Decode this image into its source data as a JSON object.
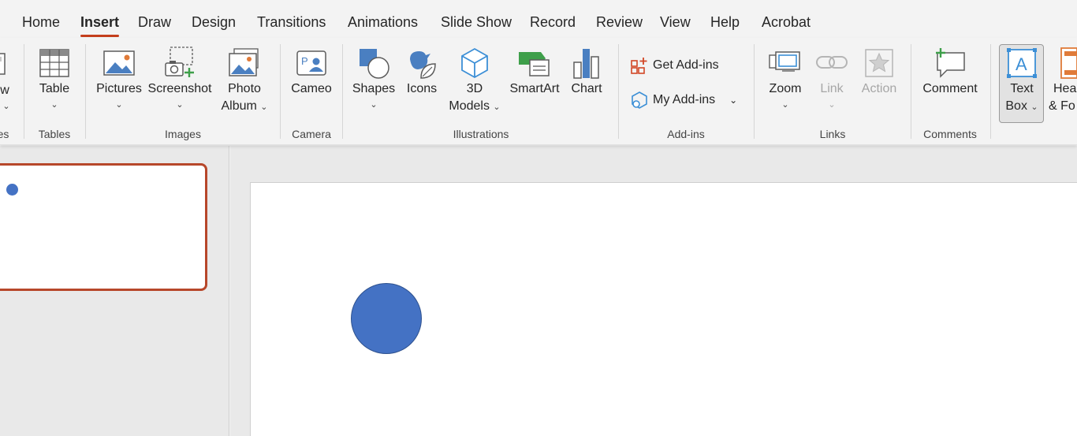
{
  "tabs": [
    {
      "label": "Home",
      "left": 0
    },
    {
      "label": "Insert",
      "active": true
    },
    {
      "label": "Draw"
    },
    {
      "label": "Design"
    },
    {
      "label": "Transitions"
    },
    {
      "label": "Animations"
    },
    {
      "label": "Slide Show"
    },
    {
      "label": "Record"
    },
    {
      "label": "Review"
    },
    {
      "label": "View"
    },
    {
      "label": "Help"
    },
    {
      "label": "Acrobat"
    }
  ],
  "ribbon": {
    "partial_left_label": "w",
    "partial_left_group": "es",
    "tables": {
      "table": "Table",
      "group": "Tables"
    },
    "images": {
      "pictures": "Pictures",
      "screenshot": "Screenshot",
      "photo_album_1": "Photo",
      "photo_album_2": "Album",
      "group": "Images"
    },
    "camera": {
      "cameo": "Cameo",
      "group": "Camera"
    },
    "illustrations": {
      "shapes": "Shapes",
      "icons": "Icons",
      "models_1": "3D",
      "models_2": "Models",
      "smartart": "SmartArt",
      "chart": "Chart",
      "group": "Illustrations"
    },
    "addins": {
      "get": "Get Add-ins",
      "my": "My Add-ins",
      "group": "Add-ins"
    },
    "links": {
      "zoom": "Zoom",
      "link": "Link",
      "action": "Action",
      "group": "Links"
    },
    "comments": {
      "comment": "Comment",
      "group": "Comments"
    },
    "text": {
      "textbox_1": "Text",
      "textbox_2": "Box",
      "header_1": "Hea",
      "header_2": "& Fo"
    }
  },
  "colors": {
    "accent": "#c43e1c",
    "shape_fill": "#4472c4",
    "selection_border": "#b7472a"
  }
}
